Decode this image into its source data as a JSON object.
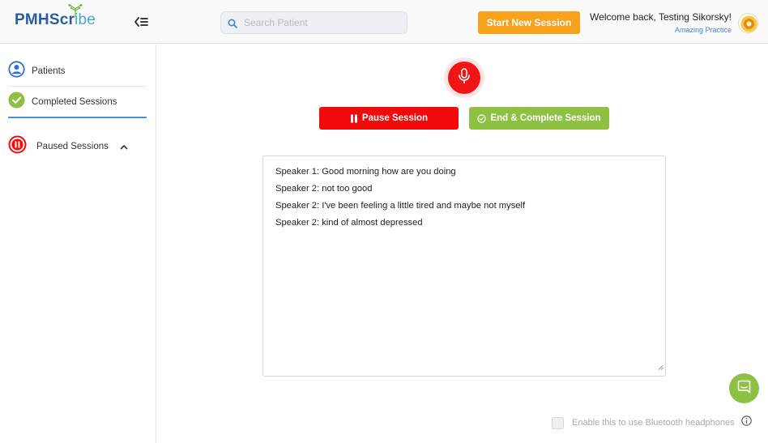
{
  "header": {
    "logo_main": "PMHScr",
    "logo_tail": "ibe",
    "search_placeholder": "Search Patient",
    "start_session_label": "Start New Session",
    "welcome_text": "Welcome back, Testing Sikorsky!",
    "practice_name": "Amazing Practice"
  },
  "sidebar": {
    "items": [
      {
        "label": "Patients",
        "icon": "user-circle-icon"
      },
      {
        "label": "Completed Sessions",
        "icon": "check-circle-icon"
      },
      {
        "label": "Paused Sessions",
        "icon": "pause-circle-icon"
      }
    ]
  },
  "session": {
    "pause_label": "Pause Session",
    "end_label": "End & Complete Session",
    "transcript": [
      "Speaker 1: Good morning how are you doing",
      "Speaker 2: not too good",
      "Speaker 2: I've been feeling a little tired and maybe not myself",
      "Speaker 2: kind of almost depressed"
    ]
  },
  "footer": {
    "bluetooth_label": "Enable this to use Bluetooth headphones"
  },
  "colors": {
    "accent_orange": "#f7a21b",
    "record_red": "#f01414",
    "success_green": "#8ec043",
    "brand_blue": "#2a5d9f"
  }
}
